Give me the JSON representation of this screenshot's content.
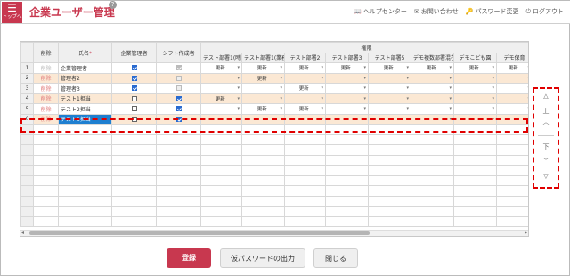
{
  "header": {
    "home_icon": "☰",
    "home_label": "トップへ",
    "title": "企業ユーザー管理",
    "help_icon": "?",
    "nav": [
      {
        "icon": "book-icon",
        "glyph": "📖",
        "label": "ヘルプセンター"
      },
      {
        "icon": "mail-icon",
        "glyph": "✉",
        "label": "お問い合わせ"
      },
      {
        "icon": "key-icon",
        "glyph": "🔑",
        "label": "パスワード変更"
      },
      {
        "icon": "logout-icon",
        "glyph": "⏻",
        "label": "ログアウト"
      }
    ]
  },
  "table": {
    "group_header": "権限",
    "columns": [
      "",
      "削除",
      "氏名",
      "企業管理者",
      "シフト作成者",
      "テスト部署1(時間",
      "テスト部署1(業務",
      "テスト部署2",
      "テスト部署3",
      "テスト部署5",
      "デモ複数部署混在",
      "デモこども園",
      "デモ保育"
    ],
    "required_mark": "*",
    "delete_label": "削除",
    "rows": [
      {
        "n": "1",
        "del_enabled": false,
        "name": "企業管理者",
        "admin": true,
        "shift": true,
        "shift_gray": true,
        "perms": [
          "更新",
          "更新",
          "更新",
          "更新",
          "更新",
          "更新",
          "更新",
          "更新"
        ],
        "alt": false,
        "selected": false
      },
      {
        "n": "2",
        "del_enabled": true,
        "name": "管理者2",
        "admin": true,
        "shift": false,
        "shift_gray": true,
        "perms": [
          "",
          "更新",
          "",
          "",
          "",
          "",
          "",
          ""
        ],
        "alt": true,
        "selected": false
      },
      {
        "n": "3",
        "del_enabled": true,
        "name": "管理者3",
        "admin": true,
        "shift": false,
        "shift_gray": true,
        "perms": [
          "",
          "",
          "更新",
          "",
          "",
          "",
          "",
          ""
        ],
        "alt": false,
        "selected": false
      },
      {
        "n": "4",
        "del_enabled": true,
        "name": "テスト1担当",
        "admin": false,
        "shift": true,
        "shift_gray": false,
        "perms": [
          "更新",
          "",
          "",
          "",
          "",
          "",
          "",
          ""
        ],
        "alt": true,
        "selected": false
      },
      {
        "n": "5",
        "del_enabled": true,
        "name": "テスト2担当",
        "admin": false,
        "shift": true,
        "shift_gray": false,
        "perms": [
          "",
          "更新",
          "更新",
          "",
          "",
          "",
          "",
          ""
        ],
        "alt": false,
        "selected": false
      },
      {
        "n": "6",
        "del_enabled": true,
        "name": "テスト3担当",
        "admin": false,
        "shift": true,
        "shift_gray": false,
        "perms": [
          "",
          "",
          "",
          "",
          "",
          "",
          "",
          ""
        ],
        "alt": true,
        "selected": true
      }
    ]
  },
  "side_panel": {
    "top_icon": "△",
    "up_label": "上",
    "up_arrow": "︿",
    "down_label": "下",
    "down_arrow": "﹀",
    "bottom_icon": "▽"
  },
  "footer": {
    "register": "登録",
    "temp_password": "仮パスワードの出力",
    "close": "閉じる"
  },
  "colors": {
    "accent": "#c8384f",
    "alt_row": "#fbe8d4",
    "selected_cell": "#1e7fd0",
    "highlight": "#e00000"
  }
}
